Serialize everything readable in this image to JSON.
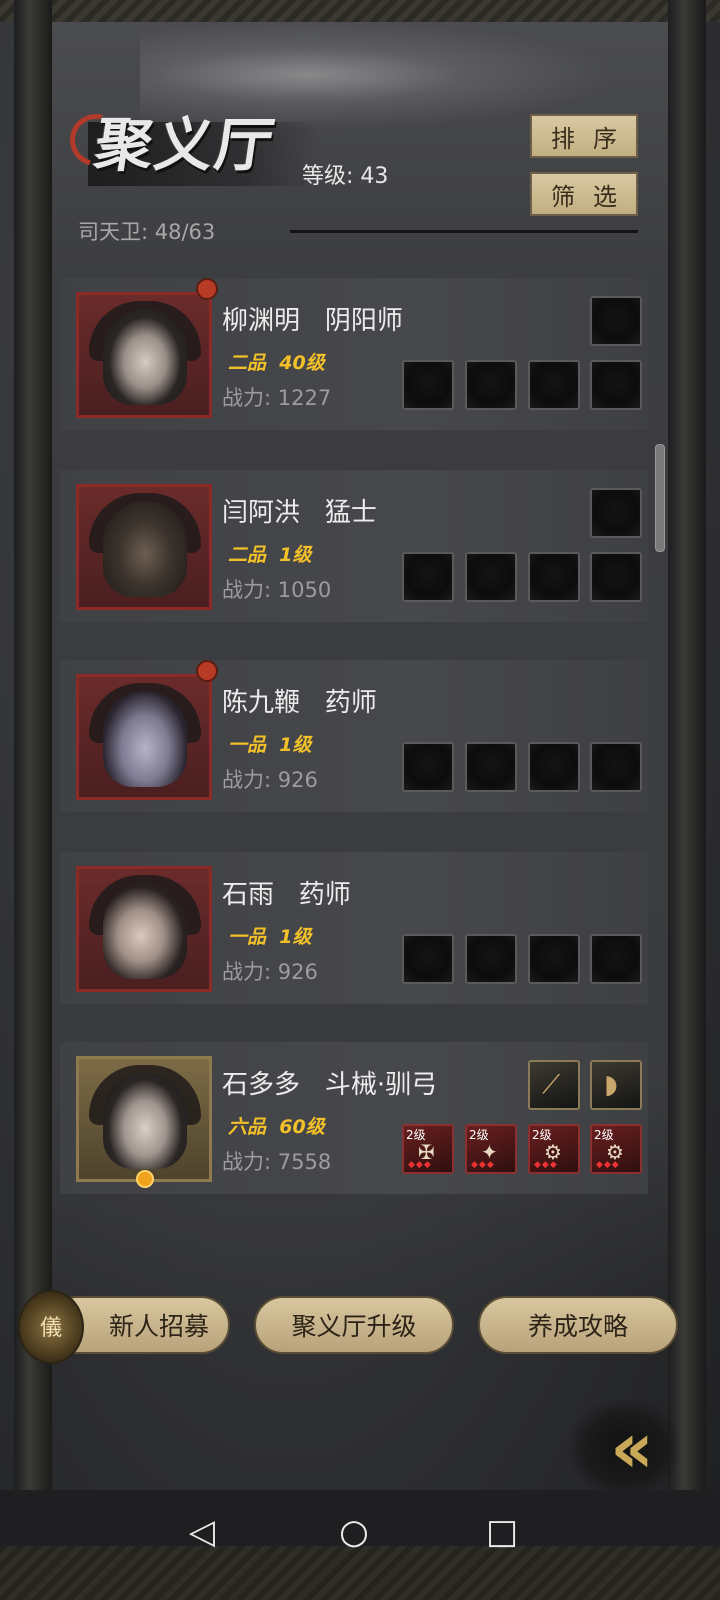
{
  "header": {
    "title": "聚义厅",
    "level_text": "等级: 43",
    "guards_text": "司天卫: 48/63",
    "sort_label": "排序",
    "filter_label": "筛选"
  },
  "heroes": [
    {
      "name": "柳渊明",
      "class": "阴阳师",
      "grade": "二品",
      "level": "40级",
      "power_label": "战力:",
      "power": "1227",
      "red_dot": true
    },
    {
      "name": "闫阿洪",
      "class": "猛士",
      "grade": "二品",
      "level": "1级",
      "power_label": "战力:",
      "power": "1050",
      "red_dot": false
    },
    {
      "name": "陈九鞭",
      "class": "药师",
      "grade": "一品",
      "level": "1级",
      "power_label": "战力:",
      "power": "926",
      "red_dot": true
    },
    {
      "name": "石雨",
      "class": "药师",
      "grade": "一品",
      "level": "1级",
      "power_label": "战力:",
      "power": "926",
      "red_dot": false
    },
    {
      "name": "石多多",
      "class": "斗械·驯弓",
      "grade": "六品",
      "level": "60级",
      "power_label": "战力:",
      "power": "7558",
      "red_dot": false,
      "gear_levels": [
        "2级",
        "2级",
        "2级",
        "2级"
      ]
    }
  ],
  "bottom_buttons": {
    "recruit": "新人招募",
    "upgrade": "聚义厅升级",
    "guide": "养成攻略"
  },
  "icons": {
    "back": "double-chevron-left-icon",
    "nav_back": "◁",
    "nav_home": "○",
    "nav_recent": "□",
    "recruit_glyph": "儀"
  },
  "colors": {
    "accent_gold": "#f2c028",
    "red_dot": "#b83b26",
    "button_tan": "#d8c7a0"
  }
}
